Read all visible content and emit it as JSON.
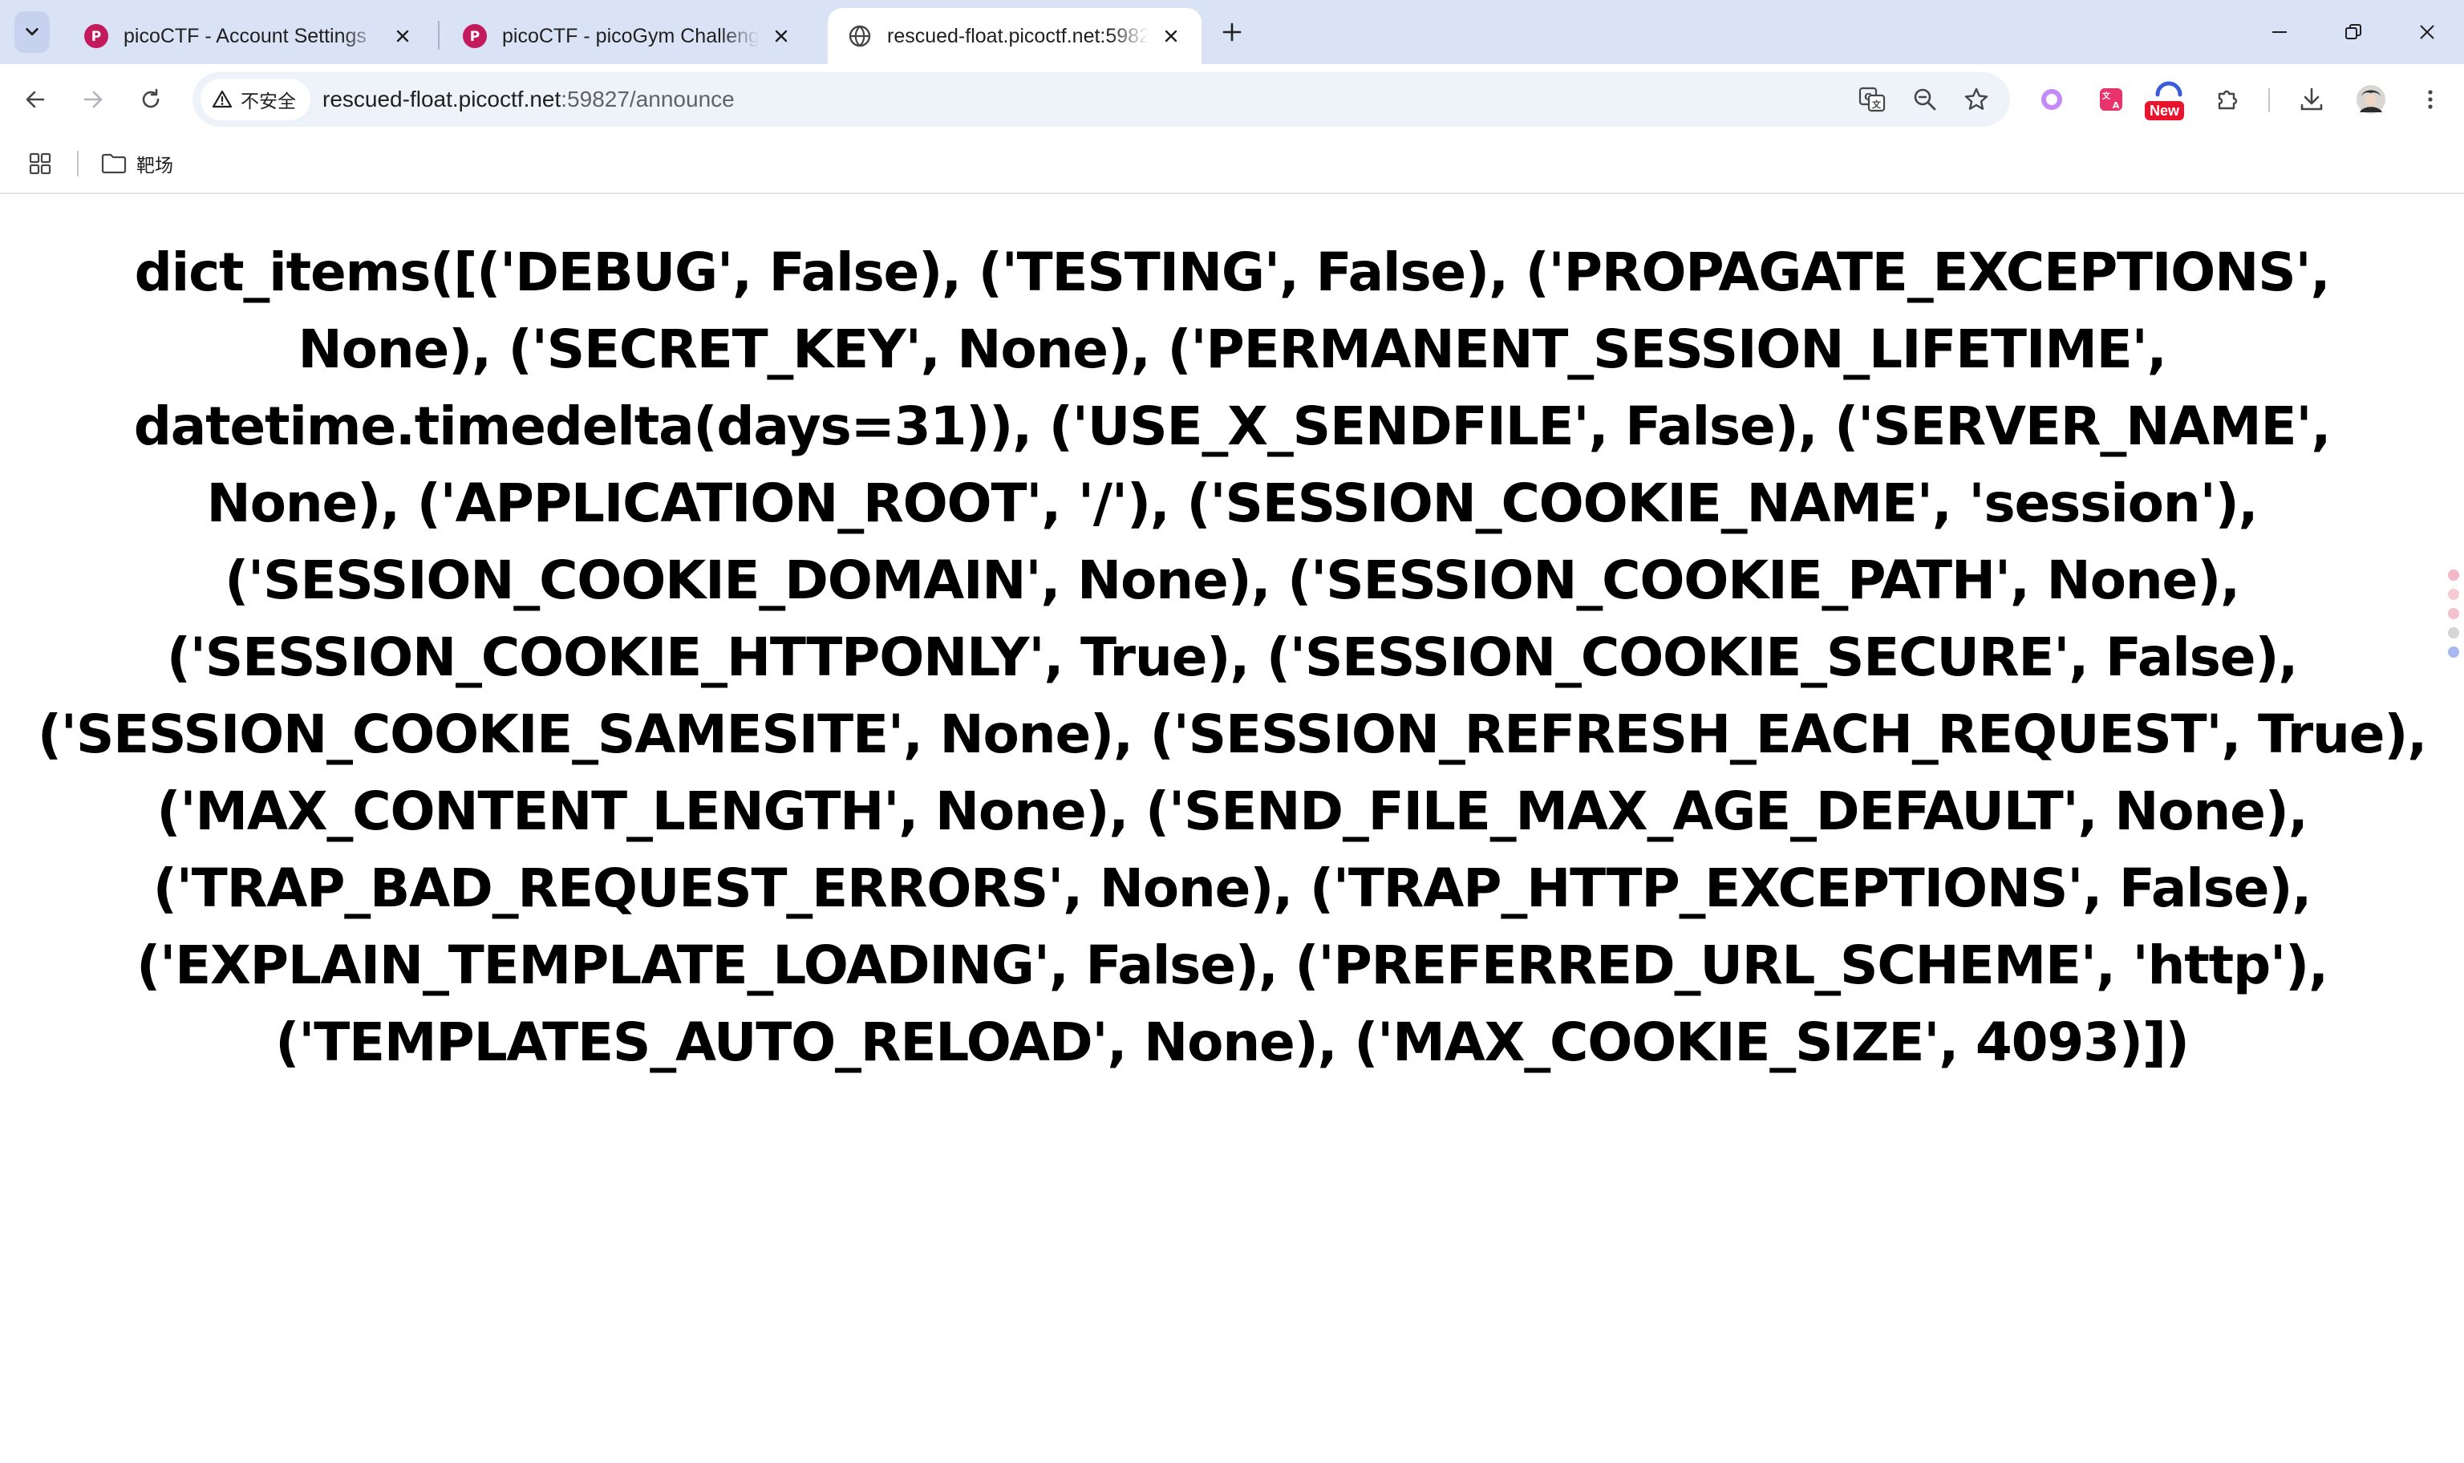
{
  "browser": {
    "tabs": [
      {
        "title": "picoCTF - Account Settings",
        "active": false,
        "favicon": "picoctf-icon"
      },
      {
        "title": "picoCTF - picoGym Challenges",
        "active": false,
        "favicon": "picoctf-icon"
      },
      {
        "title": "rescued-float.picoctf.net:59827/announce",
        "active": true,
        "favicon": "globe-icon"
      }
    ],
    "security_label": "不安全",
    "url_host": "rescued-float.picoctf.net",
    "url_path": ":59827/announce",
    "new_badge": "New",
    "bookmarks": [
      {
        "label": "靶场",
        "icon": "folder-icon"
      }
    ],
    "colors": {
      "tabstrip": "#dae2f6",
      "omnibox": "#eef2f9",
      "picoctf_brand": "#c3195d",
      "new_badge": "#e8132c"
    }
  },
  "page": {
    "content": "dict_items([('DEBUG', False), ('TESTING', False), ('PROPAGATE_EXCEPTIONS', None), ('SECRET_KEY', None), ('PERMANENT_SESSION_LIFETIME', datetime.timedelta(days=31)), ('USE_X_SENDFILE', False), ('SERVER_NAME', None), ('APPLICATION_ROOT', '/'), ('SESSION_COOKIE_NAME', 'session'), ('SESSION_COOKIE_DOMAIN', None), ('SESSION_COOKIE_PATH', None), ('SESSION_COOKIE_HTTPONLY', True), ('SESSION_COOKIE_SECURE', False), ('SESSION_COOKIE_SAMESITE', None), ('SESSION_REFRESH_EACH_REQUEST', True), ('MAX_CONTENT_LENGTH', None), ('SEND_FILE_MAX_AGE_DEFAULT', None), ('TRAP_BAD_REQUEST_ERRORS', None), ('TRAP_HTTP_EXCEPTIONS', False), ('EXPLAIN_TEMPLATE_LOADING', False), ('PREFERRED_URL_SCHEME', 'http'), ('TEMPLATES_AUTO_RELOAD', None), ('MAX_COOKIE_SIZE', 4093)])"
  }
}
